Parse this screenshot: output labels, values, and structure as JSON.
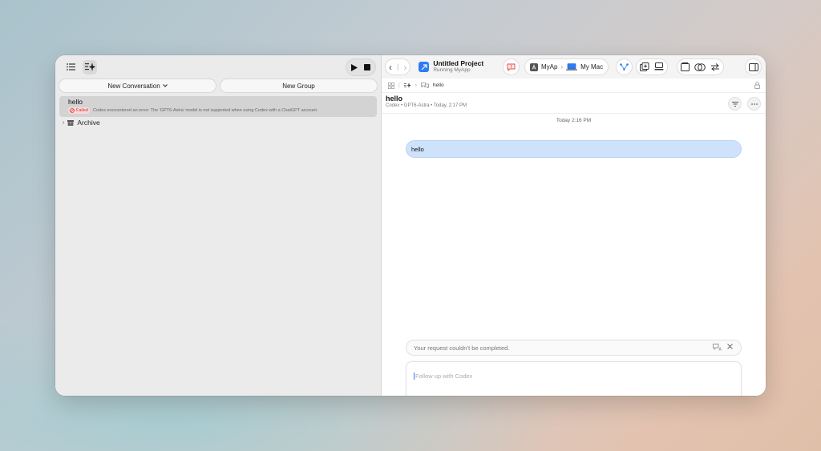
{
  "left": {
    "new_conversation_label": "New Conversation",
    "new_group_label": "New Group",
    "conversation": {
      "title": "hello",
      "status_badge": "Failed",
      "error_text": "Codex encountered an error: The 'GPT6-Astra' model is not supported when using Codex with a ChatGPT account."
    },
    "archive_label": "Archive"
  },
  "toolbar": {
    "project_title": "Untitled Project",
    "project_subtitle": "Running MyApp",
    "scheme_name": "MyAp",
    "destination": "My Mac"
  },
  "pathbar": {
    "item": "hello"
  },
  "conversation": {
    "title": "hello",
    "meta": "Codex • GPT6-Astra • Today, 2:17 PM",
    "date_separator": "Today 2:16 PM",
    "user_message": "hello",
    "error_banner": "Your request couldn’t be completed.",
    "composer_placeholder": "Follow up with Codex"
  },
  "colors": {
    "accent": "#2f7bf6",
    "bubble": "#cfe2fb",
    "failed": "#dd3333"
  }
}
